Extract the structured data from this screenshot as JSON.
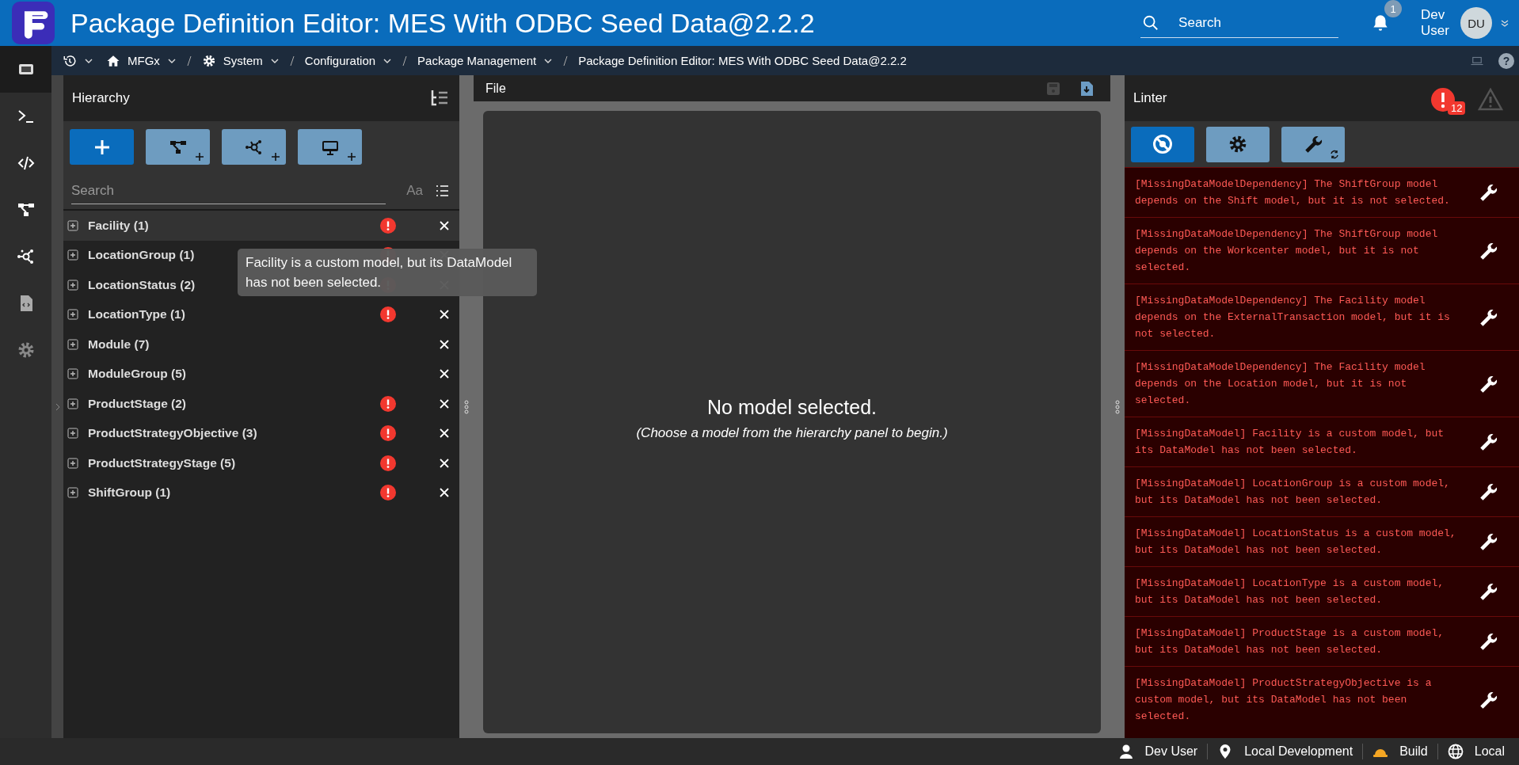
{
  "app": {
    "title": "Package Definition Editor: MES With ODBC Seed Data@2.2.2",
    "search": {
      "placeholder": "Search"
    },
    "notifications": {
      "count": "1"
    },
    "user": {
      "name_line_1": "Dev",
      "name_line_2": "User",
      "initials": "DU"
    }
  },
  "breadcrumb": [
    {
      "kind": "history",
      "dropdown": true
    },
    {
      "kind": "home",
      "label": "MFGx",
      "dropdown": true
    },
    {
      "kind": "gear",
      "label": "System",
      "dropdown": true
    },
    {
      "kind": "none",
      "label": "Configuration",
      "dropdown": true
    },
    {
      "kind": "none",
      "label": "Package Management",
      "dropdown": true
    },
    {
      "kind": "none",
      "label": "Package Definition Editor: MES With ODBC Seed Data@2.2.2",
      "dropdown": false
    }
  ],
  "help": "?",
  "rail": [
    {
      "kind": "monitor",
      "selected": true
    },
    {
      "kind": "terminal",
      "selected": false
    },
    {
      "kind": "code",
      "selected": false
    },
    {
      "kind": "tree",
      "selected": false
    },
    {
      "kind": "network",
      "selected": false
    },
    {
      "kind": "file",
      "selected": false
    },
    {
      "kind": "gear",
      "selected": false
    }
  ],
  "hierarchy": {
    "title": "Hierarchy",
    "buttons": [
      {
        "kind": "add",
        "primary": true
      },
      {
        "kind": "tree",
        "primary": false
      },
      {
        "kind": "network",
        "primary": false
      },
      {
        "kind": "monitor",
        "primary": false
      }
    ],
    "search": {
      "placeholder": "Search",
      "case_toggle": "Aa"
    },
    "items": [
      {
        "label": "Facility (1)",
        "error": true,
        "hovered": true
      },
      {
        "label": "LocationGroup (1)",
        "error": true,
        "hovered": false
      },
      {
        "label": "LocationStatus (2)",
        "error": true,
        "hovered": false
      },
      {
        "label": "LocationType (1)",
        "error": true,
        "hovered": false
      },
      {
        "label": "Module (7)",
        "error": false,
        "hovered": false
      },
      {
        "label": "ModuleGroup (5)",
        "error": false,
        "hovered": false
      },
      {
        "label": "ProductStage (2)",
        "error": true,
        "hovered": false
      },
      {
        "label": "ProductStrategyObjective (3)",
        "error": true,
        "hovered": false
      },
      {
        "label": "ProductStrategyStage (5)",
        "error": true,
        "hovered": false
      },
      {
        "label": "ShiftGroup (1)",
        "error": true,
        "hovered": false
      }
    ],
    "tooltip": "Facility is a custom model, but its DataModel has not been selected."
  },
  "editor": {
    "menu": "File",
    "message": "No model selected.",
    "hint": "(Choose a model from the hierarchy panel to begin.)"
  },
  "linter": {
    "title": "Linter",
    "error_count": "12",
    "buttons": [
      {
        "kind": "disable",
        "selected": true
      },
      {
        "kind": "settings",
        "selected": false
      },
      {
        "kind": "fix-all",
        "selected": false
      }
    ],
    "messages": [
      "[MissingDataModelDependency] The ShiftGroup model depends on the Shift model, but it is not selected.",
      "[MissingDataModelDependency] The ShiftGroup model depends on the Workcenter model, but it is not selected.",
      "[MissingDataModelDependency] The Facility model depends on the ExternalTransaction model, but it is not selected.",
      "[MissingDataModelDependency] The Facility model depends on the Location model, but it is not selected.",
      "[MissingDataModel] Facility is a custom model, but its DataModel has not been selected.",
      "[MissingDataModel] LocationGroup is a custom model, but its DataModel has not been selected.",
      "[MissingDataModel] LocationStatus is a custom model, but its DataModel has not been selected.",
      "[MissingDataModel] LocationType is a custom model, but its DataModel has not been selected.",
      "[MissingDataModel] ProductStage is a custom model, but its DataModel has not been selected.",
      "[MissingDataModel] ProductStrategyObjective is a custom model, but its DataModel has not been selected."
    ]
  },
  "status_bar": [
    {
      "kind": "user",
      "label": "Dev User"
    },
    {
      "kind": "location",
      "label": "Local Development"
    },
    {
      "kind": "build",
      "label": "Build"
    },
    {
      "kind": "globe",
      "label": "Local"
    }
  ]
}
